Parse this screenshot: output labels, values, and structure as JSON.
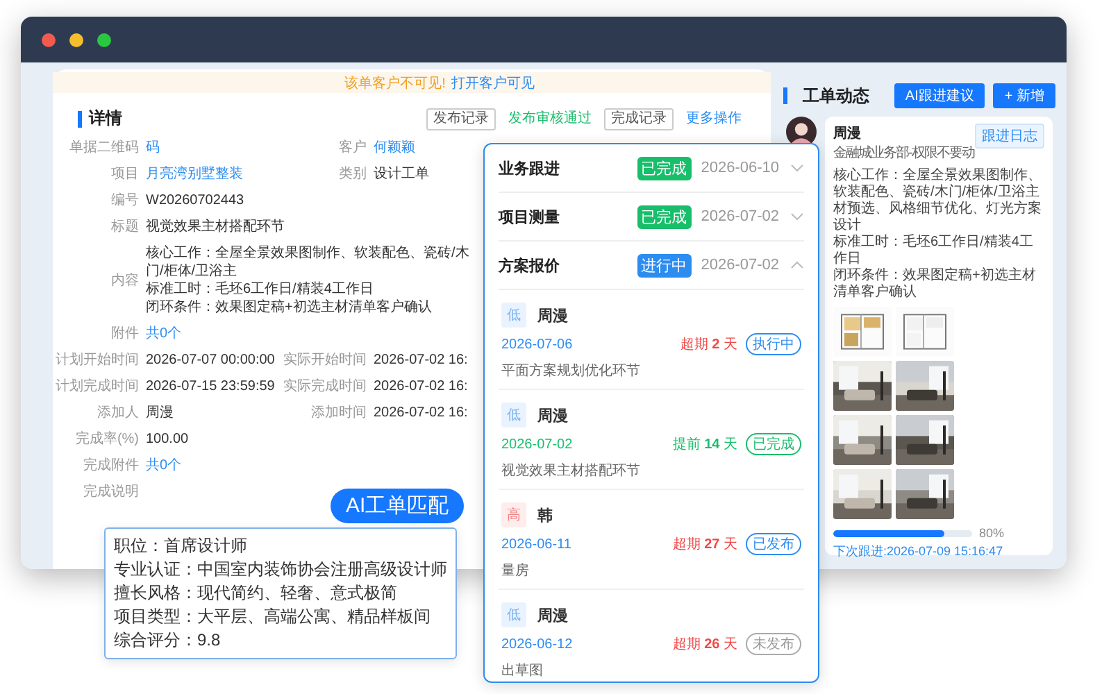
{
  "notice": {
    "warning": "该单客户不可见!",
    "link": "打开客户可见"
  },
  "detail": {
    "title": "详情",
    "actions": [
      {
        "label": "发布记录",
        "kind": "outline"
      },
      {
        "label": "发布审核通过",
        "kind": "success"
      },
      {
        "label": "完成记录",
        "kind": "outline"
      },
      {
        "label": "更多操作",
        "kind": "link"
      }
    ],
    "rows": [
      {
        "cells": [
          {
            "label": "单据二维码",
            "value": "码",
            "kind": "link"
          },
          {
            "label": "客户",
            "value": "何颖颖",
            "kind": "link"
          }
        ]
      },
      {
        "cells": [
          {
            "label": "项目",
            "value": "月亮湾别墅整装",
            "kind": "link"
          },
          {
            "label": "类别",
            "value": "设计工单",
            "kind": "text"
          }
        ]
      },
      {
        "cells": [
          {
            "label": "编号",
            "value": "W20260702443",
            "kind": "text"
          }
        ]
      },
      {
        "cells": [
          {
            "label": "标题",
            "value": "视觉效果主材搭配环节",
            "kind": "text"
          }
        ]
      },
      {
        "cells": [
          {
            "label": "内容",
            "kind": "lines",
            "lines": [
              "核心工作：全屋全景效果图制作、软装配色、瓷砖/木门/柜体/卫浴主",
              "标准工时：毛坯6工作日/精装4工作日",
              "闭环条件：效果图定稿+初选主材清单客户确认"
            ]
          }
        ]
      },
      {
        "cells": [
          {
            "label": "附件",
            "value": "共0个",
            "kind": "link"
          }
        ]
      },
      {
        "cells": [
          {
            "label": "计划开始时间",
            "value": "2026-07-07 00:00:00",
            "kind": "text"
          },
          {
            "label": "实际开始时间",
            "value": "2026-07-02 16:",
            "kind": "text"
          }
        ]
      },
      {
        "cells": [
          {
            "label": "计划完成时间",
            "value": "2026-07-15 23:59:59",
            "kind": "text"
          },
          {
            "label": "实际完成时间",
            "value": "2026-07-02 16:",
            "kind": "text"
          }
        ]
      },
      {
        "cells": [
          {
            "label": "添加人",
            "value": "周漫",
            "kind": "text"
          },
          {
            "label": "添加时间",
            "value": "2026-07-02 16:",
            "kind": "text"
          }
        ]
      },
      {
        "cells": [
          {
            "label": "完成率(%)",
            "value": "100.00",
            "kind": "text"
          }
        ]
      },
      {
        "cells": [
          {
            "label": "完成附件",
            "value": "共0个",
            "kind": "link"
          }
        ]
      },
      {
        "cells": [
          {
            "label": "完成说明",
            "kind": "text"
          }
        ]
      }
    ]
  },
  "activity": {
    "title": "工单动态",
    "buttons": [
      "AI跟进建议",
      "+ 新增"
    ],
    "card": {
      "name": "周漫",
      "subtitle": "金融城业务部-权限不要动",
      "log_button": "跟进日志",
      "paragraphs": [
        "核心工作：全屋全景效果图制作、软装配色、瓷砖/木门/柜体/卫浴主材预选、风格细节优化、灯光方案设计",
        "标准工时：毛坯6工作日/精装4工作日",
        "闭环条件：效果图定稿+初选主材清单客户确认"
      ],
      "images": [
        {
          "kind": "floorplan"
        },
        {
          "kind": "floorplan"
        },
        {
          "kind": "picture"
        },
        {
          "kind": "picture"
        },
        {
          "kind": "picture"
        },
        {
          "kind": "picture"
        },
        {
          "kind": "picture"
        },
        {
          "kind": "picture"
        }
      ],
      "progress": {
        "level": 0.8,
        "reading": "80%"
      },
      "next_follow": "下次跟进:2026-07-09 15:16:47"
    }
  },
  "stages": [
    {
      "title": "业务跟进",
      "status": "已完成",
      "kind": "done",
      "date": "2026-06-10",
      "expanded": false
    },
    {
      "title": "项目测量",
      "status": "已完成",
      "kind": "done",
      "date": "2026-07-02",
      "expanded": false
    },
    {
      "title": "方案报价",
      "status": "进行中",
      "kind": "active",
      "date": "2026-07-02",
      "expanded": true,
      "tasks": [
        {
          "priority": {
            "text": "低",
            "kind": "low"
          },
          "name": "周漫",
          "date": "2026-07-06",
          "timing": {
            "text": "超期 **2** 天",
            "kind": "overdue"
          },
          "status": {
            "text": "执行中",
            "kind": "running"
          },
          "description": "平面方案规划优化环节"
        },
        {
          "priority": {
            "text": "低",
            "kind": "low"
          },
          "name": "周漫",
          "date": "2026-07-02",
          "timing": {
            "text": "提前 **14** 天",
            "kind": "early"
          },
          "status": {
            "text": "已完成",
            "kind": "done"
          },
          "description": "视觉效果主材搭配环节"
        },
        {
          "priority": {
            "text": "高",
            "kind": "high"
          },
          "name": "韩",
          "date": "2026-06-11",
          "timing": {
            "text": "超期 **27** 天",
            "kind": "overdue"
          },
          "status": {
            "text": "已发布",
            "kind": "published"
          },
          "description": "量房"
        },
        {
          "priority": {
            "text": "低",
            "kind": "low"
          },
          "name": "周漫",
          "date": "2026-06-12",
          "timing": {
            "text": "超期 **26** 天",
            "kind": "overdue"
          },
          "status": {
            "text": "未发布",
            "kind": "draft"
          },
          "description": "出草图"
        }
      ]
    }
  ],
  "ai_tag": "AI工单匹配",
  "match_tooltip": [
    "职位：首席设计师",
    "专业认证：中国室内装饰协会注册高级设计师",
    "擅长风格：现代简约、轻奢、意式极简",
    "项目类型：大平层、高端公寓、精品样板间",
    "综合评分：9.8"
  ]
}
